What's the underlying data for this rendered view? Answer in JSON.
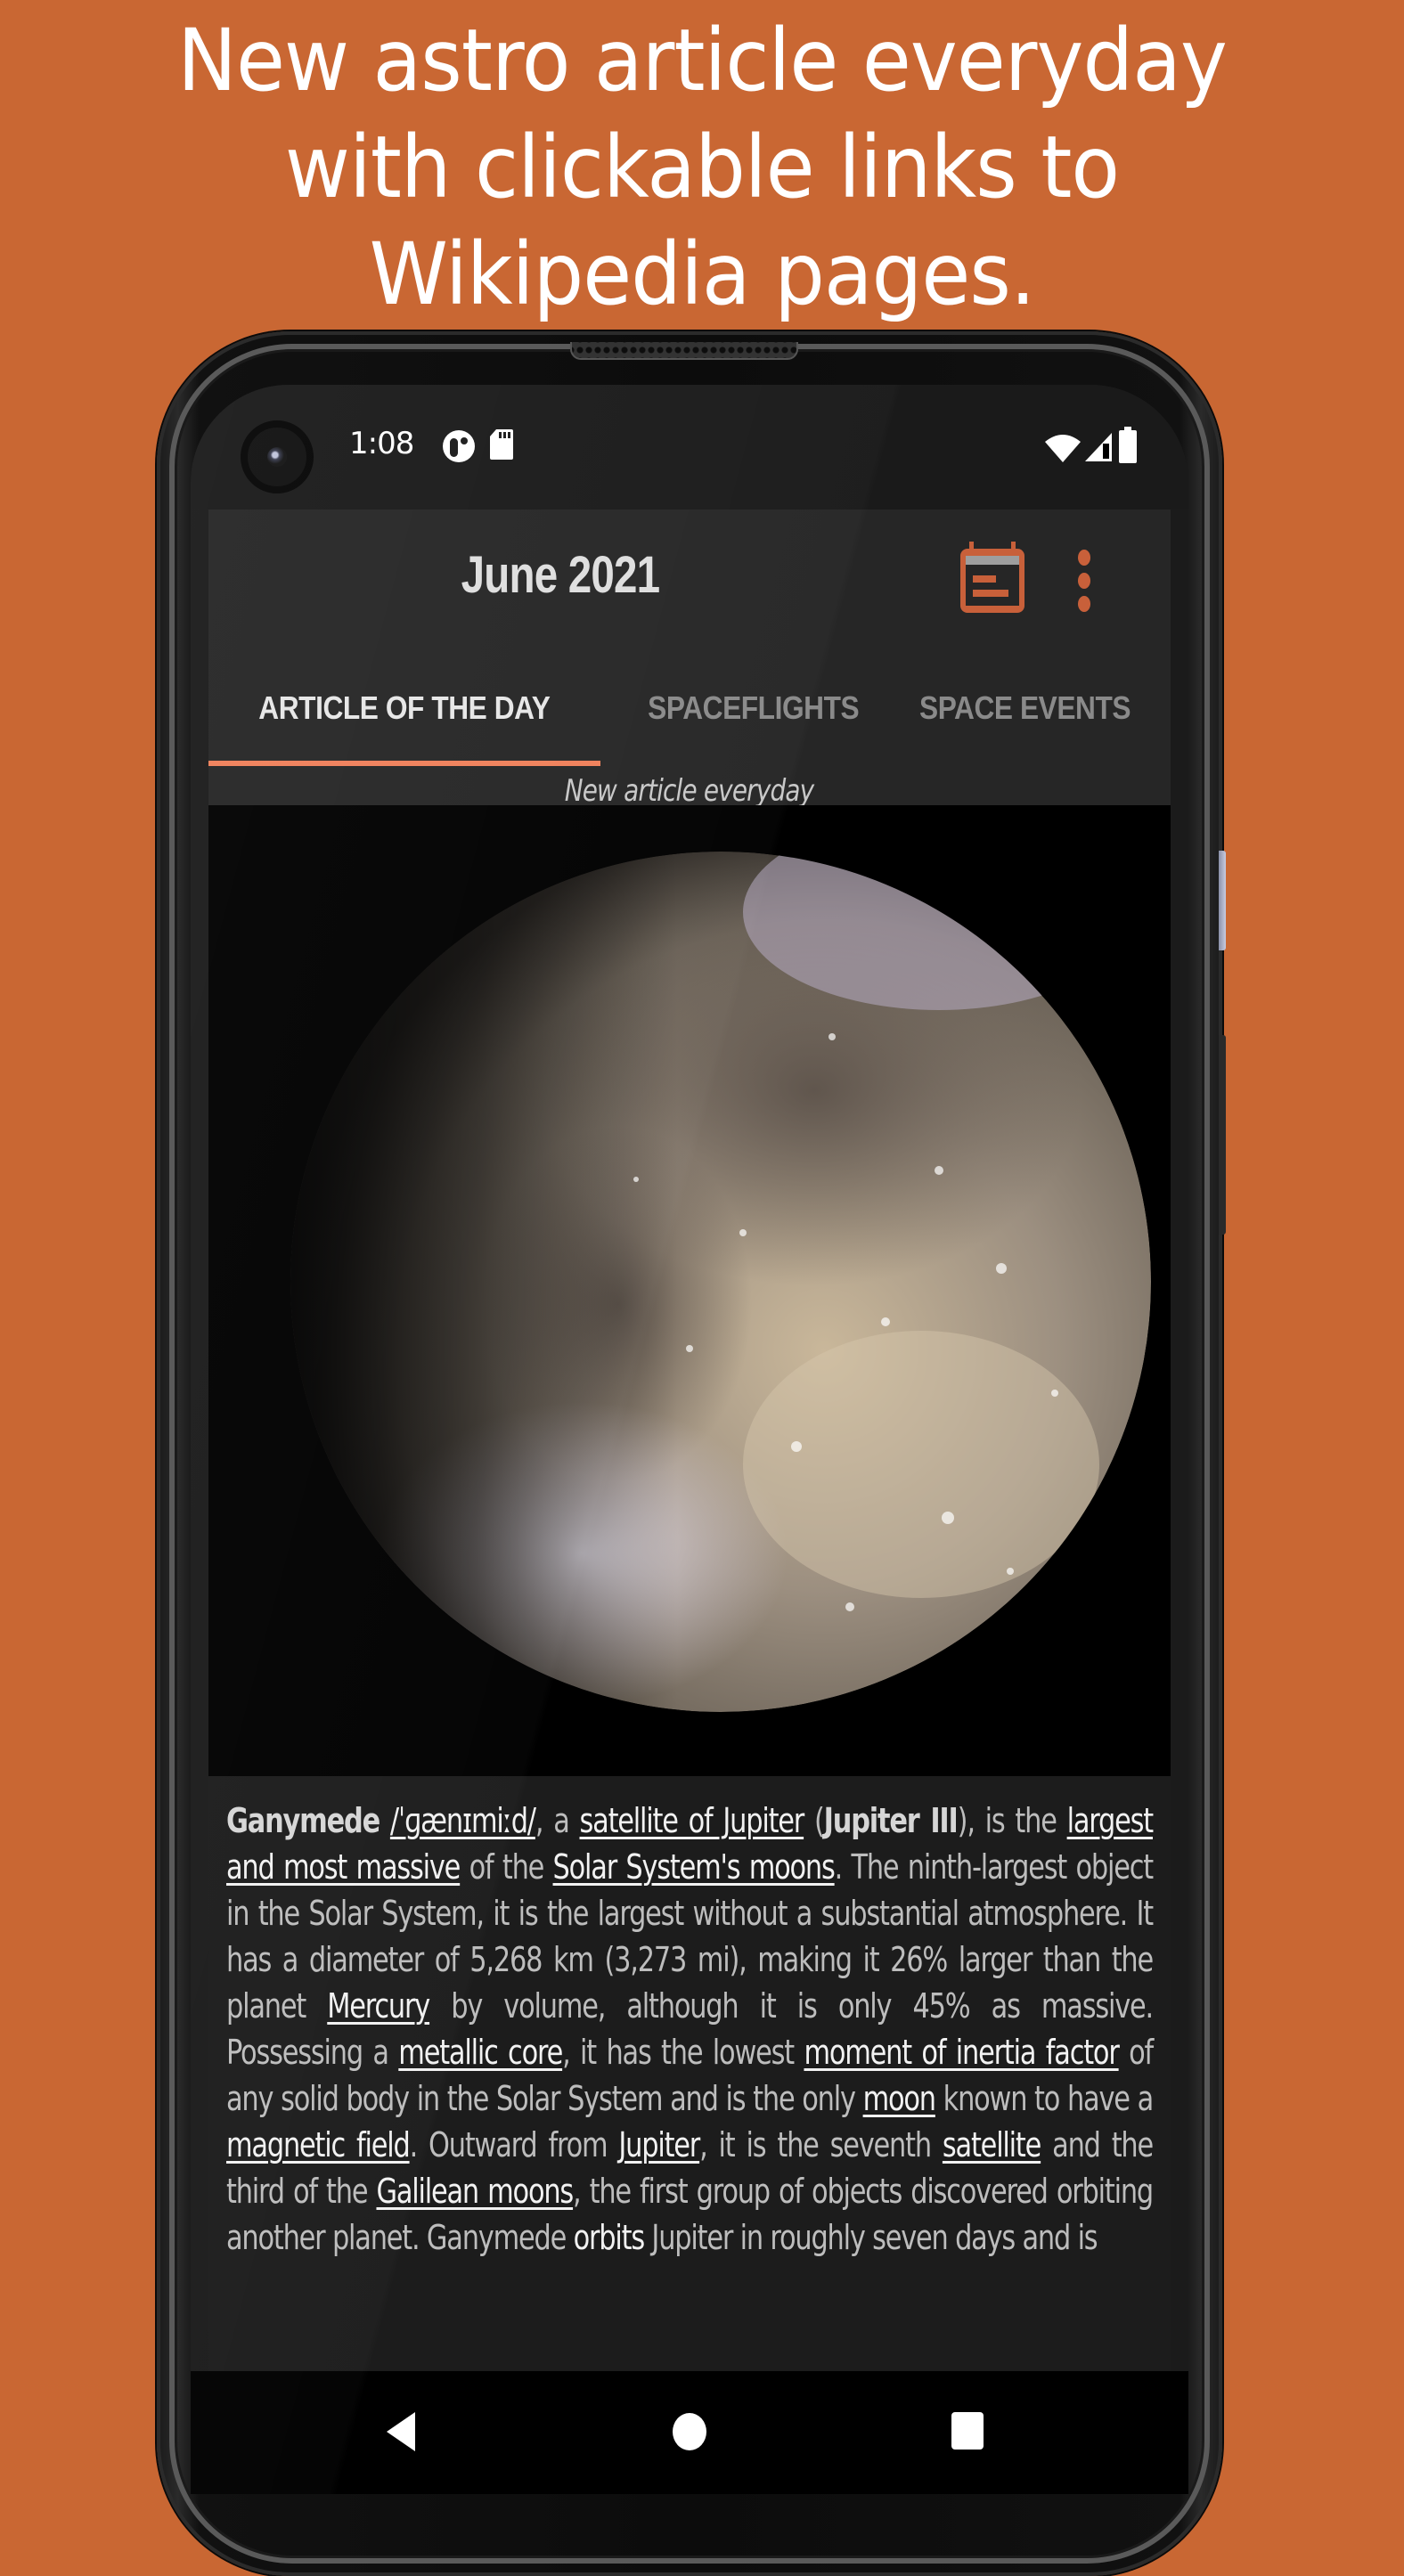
{
  "promo": {
    "lines": [
      "New astro article everyday",
      "with clickable links to",
      "Wikipedia pages."
    ]
  },
  "status_bar": {
    "time": "1:08",
    "left_icons": [
      "app-notification-icon",
      "sd-card-icon"
    ],
    "right_icons": [
      "wifi-icon",
      "cell-signal-icon",
      "battery-icon"
    ]
  },
  "app_bar": {
    "title": "June 2021",
    "actions": [
      "calendar-icon",
      "more-vert-icon"
    ],
    "accent_color": "#c8603a"
  },
  "tabs": [
    {
      "label": "ARTICLE OF THE DAY",
      "active": true
    },
    {
      "label": "SPACEFLIGHTS",
      "active": false
    },
    {
      "label": "SPACE EVENTS",
      "active": false
    }
  ],
  "tab_indicator_color": "#f0805a",
  "subtitle": "New article everyday",
  "article": {
    "image_subject": "Ganymede",
    "segments": [
      {
        "t": "Ganymede",
        "s": "bold"
      },
      {
        "t": " "
      },
      {
        "t": "/ˈɡænɪmiːd/",
        "s": "link"
      },
      {
        "t": ", a "
      },
      {
        "t": "satellite of Jupiter",
        "s": "link"
      },
      {
        "t": " ("
      },
      {
        "t": "Jupiter III",
        "s": "bold"
      },
      {
        "t": "), is the "
      },
      {
        "t": "largest and most massive",
        "s": "link"
      },
      {
        "t": " of the "
      },
      {
        "t": "Solar System's moons",
        "s": "link"
      },
      {
        "t": ". The ninth-largest object in the Solar System, it is the largest without a substantial atmosphere. It has a diameter of 5,268 km (3,273 mi), making it 26% larger than the planet "
      },
      {
        "t": "Mercury",
        "s": "link"
      },
      {
        "t": " by volume, although it is only 45% as massive. Possessing a "
      },
      {
        "t": "metallic core",
        "s": "link"
      },
      {
        "t": ", it has the lowest "
      },
      {
        "t": "moment of inertia factor",
        "s": "link"
      },
      {
        "t": " of any solid body in the Solar System and is the only "
      },
      {
        "t": "moon",
        "s": "link"
      },
      {
        "t": " known to have a "
      },
      {
        "t": "magnetic field",
        "s": "link"
      },
      {
        "t": ". Outward from "
      },
      {
        "t": "Jupiter",
        "s": "link"
      },
      {
        "t": ", it is the seventh "
      },
      {
        "t": "satellite",
        "s": "link"
      },
      {
        "t": " and the third of the "
      },
      {
        "t": "Galilean moons",
        "s": "link"
      },
      {
        "t": ", the first group of objects discovered orbiting another planet. Ganymede "
      },
      {
        "t": "orbits",
        "s": "link-plain"
      },
      {
        "t": " Jupiter in roughly seven days and is"
      }
    ]
  },
  "nav_bar": {
    "buttons": [
      "back",
      "home",
      "recents"
    ]
  }
}
